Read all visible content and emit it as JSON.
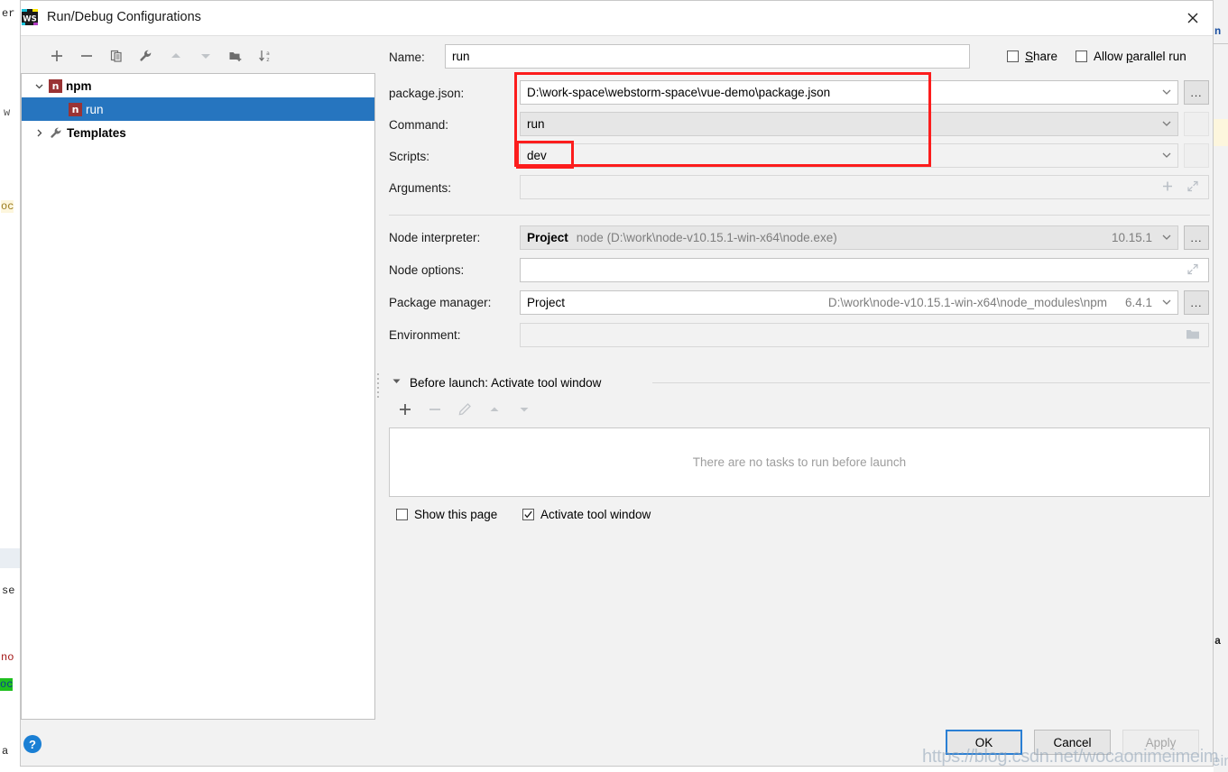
{
  "window": {
    "title": "Run/Debug Configurations",
    "app_icon": "webstorm-icon",
    "close_icon": "close-icon"
  },
  "left_panel": {
    "toolbar": [
      {
        "name": "add-configuration-button",
        "icon": "plus-icon"
      },
      {
        "name": "remove-configuration-button",
        "icon": "minus-icon"
      },
      {
        "name": "copy-configuration-button",
        "icon": "copy-icon"
      },
      {
        "name": "edit-templates-button",
        "icon": "wrench-icon"
      },
      {
        "name": "move-up-button",
        "icon": "arrow-up-icon"
      },
      {
        "name": "move-down-button",
        "icon": "arrow-down-icon"
      },
      {
        "name": "new-folder-button",
        "icon": "folder-add-icon"
      },
      {
        "name": "sort-configurations-button",
        "icon": "sort-alpha-icon"
      }
    ],
    "tree": [
      {
        "label": "npm",
        "icon": "npm-icon",
        "twisty": "chevron-down-icon",
        "depth": 0,
        "selected": false,
        "bold": true
      },
      {
        "label": "run",
        "icon": "npm-icon",
        "twisty": "",
        "depth": 1,
        "selected": true,
        "bold": false
      },
      {
        "label": "Templates",
        "icon": "wrench-icon",
        "twisty": "chevron-right-icon",
        "depth": 0,
        "selected": false,
        "bold": true
      }
    ]
  },
  "form": {
    "name": {
      "label": "Name:",
      "value": "run"
    },
    "share": {
      "label_pre": "",
      "label_mnemonic": "S",
      "label_post": "hare",
      "checked": false
    },
    "allow_parallel_run": {
      "label_pre": "Allow ",
      "label_mnemonic": "p",
      "label_post": "arallel run",
      "checked": false
    },
    "package_json": {
      "label": "package.json:",
      "value": "D:\\work-space\\webstorm-space\\vue-demo\\package.json",
      "browse_label": "...",
      "dropdown_icon": "chevron-down-icon"
    },
    "command": {
      "label": "Command:",
      "value": "run",
      "browse_label": "",
      "dropdown_icon": "chevron-down-icon"
    },
    "scripts": {
      "label": "Scripts:",
      "value": "dev",
      "browse_label": "",
      "dropdown_icon": "chevron-down-icon"
    },
    "arguments": {
      "label": "Arguments:",
      "value": "",
      "add_icon": "plus-icon",
      "expand_icon": "expand-icon"
    },
    "node_interpreter": {
      "label": "Node interpreter:",
      "value_primary": "Project",
      "value_secondary": "node (D:\\work\\node-v10.15.1-win-x64\\node.exe)",
      "version": "10.15.1",
      "browse_label": "...",
      "dropdown_icon": "chevron-down-icon"
    },
    "node_options": {
      "label": "Node options:",
      "value": "",
      "expand_icon": "expand-icon"
    },
    "package_manager": {
      "label": "Package manager:",
      "value_primary": "Project",
      "value_secondary": "D:\\work\\node-v10.15.1-win-x64\\node_modules\\npm",
      "version": "6.4.1",
      "browse_label": "...",
      "dropdown_icon": "chevron-down-icon"
    },
    "environment": {
      "label": "Environment:",
      "value": "",
      "folder_icon": "folder-icon"
    }
  },
  "before_launch": {
    "twisty_icon": "chevron-down-icon",
    "title": "Before launch: Activate tool window",
    "toolbar": [
      {
        "name": "add-task-button",
        "icon": "plus-icon",
        "enabled": true
      },
      {
        "name": "remove-task-button",
        "icon": "minus-icon",
        "enabled": false
      },
      {
        "name": "edit-task-button",
        "icon": "pencil-icon",
        "enabled": false
      },
      {
        "name": "move-task-up-button",
        "icon": "arrow-up-icon",
        "enabled": false
      },
      {
        "name": "move-task-down-button",
        "icon": "arrow-down-icon",
        "enabled": false
      }
    ],
    "empty_text": "There are no tasks to run before launch",
    "show_this_page": {
      "label": "Show this page",
      "checked": false
    },
    "activate_tool_window": {
      "label": "Activate tool window",
      "checked": true
    }
  },
  "footer": {
    "help_label": "?",
    "ok_label": "OK",
    "cancel_label": "Cancel",
    "apply_label": "Apply"
  },
  "watermark": "https://blog.csdn.net/wocaonimeimeim",
  "colors": {
    "selection_blue": "#2675bf",
    "annotation_red": "#fc1d1d",
    "default_button_border": "#2a7fd4",
    "npm_red": "#9a3334",
    "help_blue": "#1a7fd4"
  },
  "background_fragments": {
    "left": [
      "er",
      "w",
      "oc",
      "se",
      "no",
      "oc",
      "a"
    ],
    "right": [
      "n",
      "a",
      "eim"
    ]
  }
}
